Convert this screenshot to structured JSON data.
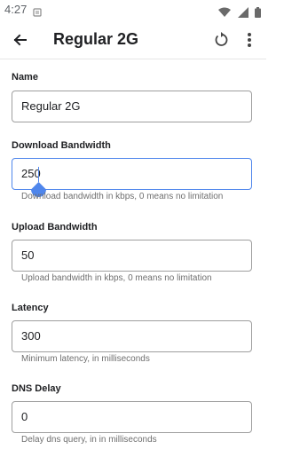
{
  "status_bar": {
    "time": "4:27",
    "icons": [
      "notification-icon",
      "wifi-icon",
      "cellular-icon",
      "battery-icon"
    ]
  },
  "app_bar": {
    "title": "Regular 2G",
    "icons": [
      "back-arrow-icon",
      "reset-icon",
      "more-vert-icon"
    ]
  },
  "form": {
    "name": {
      "label": "Name",
      "value": "Regular 2G"
    },
    "download": {
      "label": "Download Bandwidth",
      "value": "250",
      "helper": "Download bandwidth in kbps, 0 means no limitation"
    },
    "upload": {
      "label": "Upload Bandwidth",
      "value": "50",
      "helper": "Upload bandwidth in kbps, 0 means no limitation"
    },
    "latency": {
      "label": "Latency",
      "value": "300",
      "helper": "Minimum latency, in milliseconds"
    },
    "dns": {
      "label": "DNS Delay",
      "value": "0",
      "helper": "Delay dns query, in in milliseconds"
    }
  },
  "colors": {
    "accent": "#4f86ec",
    "border": "#9e9e9e",
    "helper_text": "#6f6f6f"
  }
}
